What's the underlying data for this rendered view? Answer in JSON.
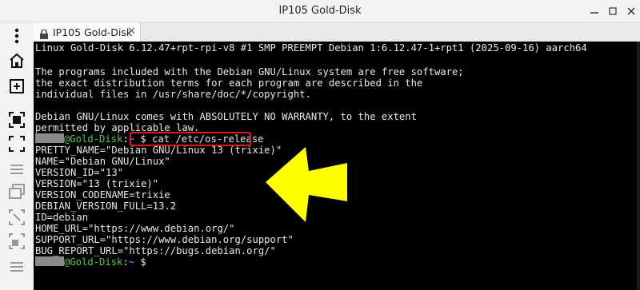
{
  "window": {
    "title": "IP105 Gold-Disk"
  },
  "tab": {
    "label": "IP105 Gold-Disk",
    "close_glyph": "✕"
  },
  "sidebar": {
    "icons": [
      "kebab-menu-icon",
      "home-icon",
      "new-tab-icon",
      "focus-icon",
      "fullscreen-icon",
      "list-icon",
      "duplicate-icon",
      "split-icon",
      "shrink-icon",
      "menu-icon"
    ]
  },
  "terminal": {
    "lines": [
      "Linux Gold-Disk 6.12.47+rpt-rpi-v8 #1 SMP PREEMPT Debian 1:6.12.47-1+rpt1 (2025-09-16) aarch64",
      "",
      "The programs included with the Debian GNU/Linux system are free software;",
      "the exact distribution terms for each program are described in the",
      "individual files in /usr/share/doc/*/copyright.",
      "",
      "Debian GNU/Linux comes with ABSOLUTELY NO WARRANTY, to the extent",
      "permitted by applicable law."
    ],
    "prompt": {
      "host": "@Gold-Disk",
      "sep": ":",
      "path": "~",
      "symbol": " $"
    },
    "command": "cat /etc/os-release",
    "output": [
      "PRETTY_NAME=\"Debian GNU/Linux 13 (trixie)\"",
      "NAME=\"Debian GNU/Linux\"",
      "VERSION_ID=\"13\"",
      "VERSION=\"13 (trixie)\"",
      "VERSION_CODENAME=trixie",
      "DEBIAN_VERSION_FULL=13.2",
      "ID=debian",
      "HOME_URL=\"https://www.debian.org/\"",
      "SUPPORT_URL=\"https://www.debian.org/support\"",
      "BUG_REPORT_URL=\"https://bugs.debian.org/\""
    ]
  },
  "colors": {
    "highlight_box": "#e21818",
    "arrow": "#ffff00"
  }
}
